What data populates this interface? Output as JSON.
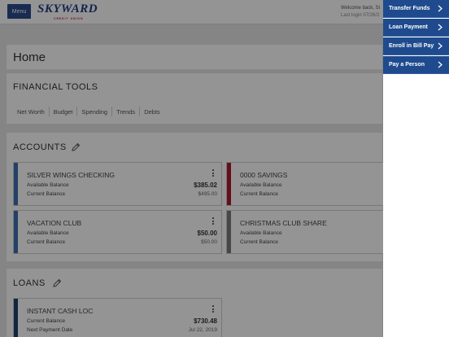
{
  "header": {
    "menu_label": "Menu",
    "logo_text": "SKYWARD",
    "logo_sub": "CREDIT UNION",
    "welcome": "Welcome back, Si",
    "last_login": "Last login 07/26/2"
  },
  "home": {
    "title": "Home"
  },
  "financial_tools": {
    "title": "FINANCIAL TOOLS",
    "tabs": [
      "Net Worth",
      "Budget",
      "Spending",
      "Trends",
      "Debts"
    ]
  },
  "accounts": {
    "title": "ACCOUNTS",
    "items": [
      {
        "name": "SILVER WINGS CHECKING",
        "label1": "Available Balance",
        "value1": "$385.02",
        "label2": "Current Balance",
        "value2": "$495.00",
        "color": "#3d6fb0"
      },
      {
        "name": "0000 SAVINGS",
        "label1": "Available Balance",
        "value1": "",
        "label2": "Current Balance",
        "value2": "",
        "color": "#b0162e"
      },
      {
        "name": "VACATION CLUB",
        "label1": "Available Balance",
        "value1": "$50.00",
        "label2": "Current Balance",
        "value2": "$50.00",
        "color": "#3d6fb0"
      },
      {
        "name": "CHRISTMAS CLUB SHARE",
        "label1": "Available Balance",
        "value1": "",
        "label2": "Current Balance",
        "value2": "",
        "color": "#7a7a7a"
      }
    ]
  },
  "loans": {
    "title": "LOANS",
    "items": [
      {
        "name": "INSTANT CASH LOC",
        "label1": "Current Balance",
        "value1": "$730.48",
        "label2": "Next Payment Date",
        "value2": "Jul 22, 2019",
        "color": "#1f3e6e"
      }
    ]
  },
  "quick_menu": {
    "items": [
      "Transfer Funds",
      "Loan Payment",
      "Enroll in Bill Pay",
      "Pay a Person"
    ]
  },
  "colors": {
    "brand_blue": "#1f4b8e",
    "accent_red": "#c8102e"
  }
}
